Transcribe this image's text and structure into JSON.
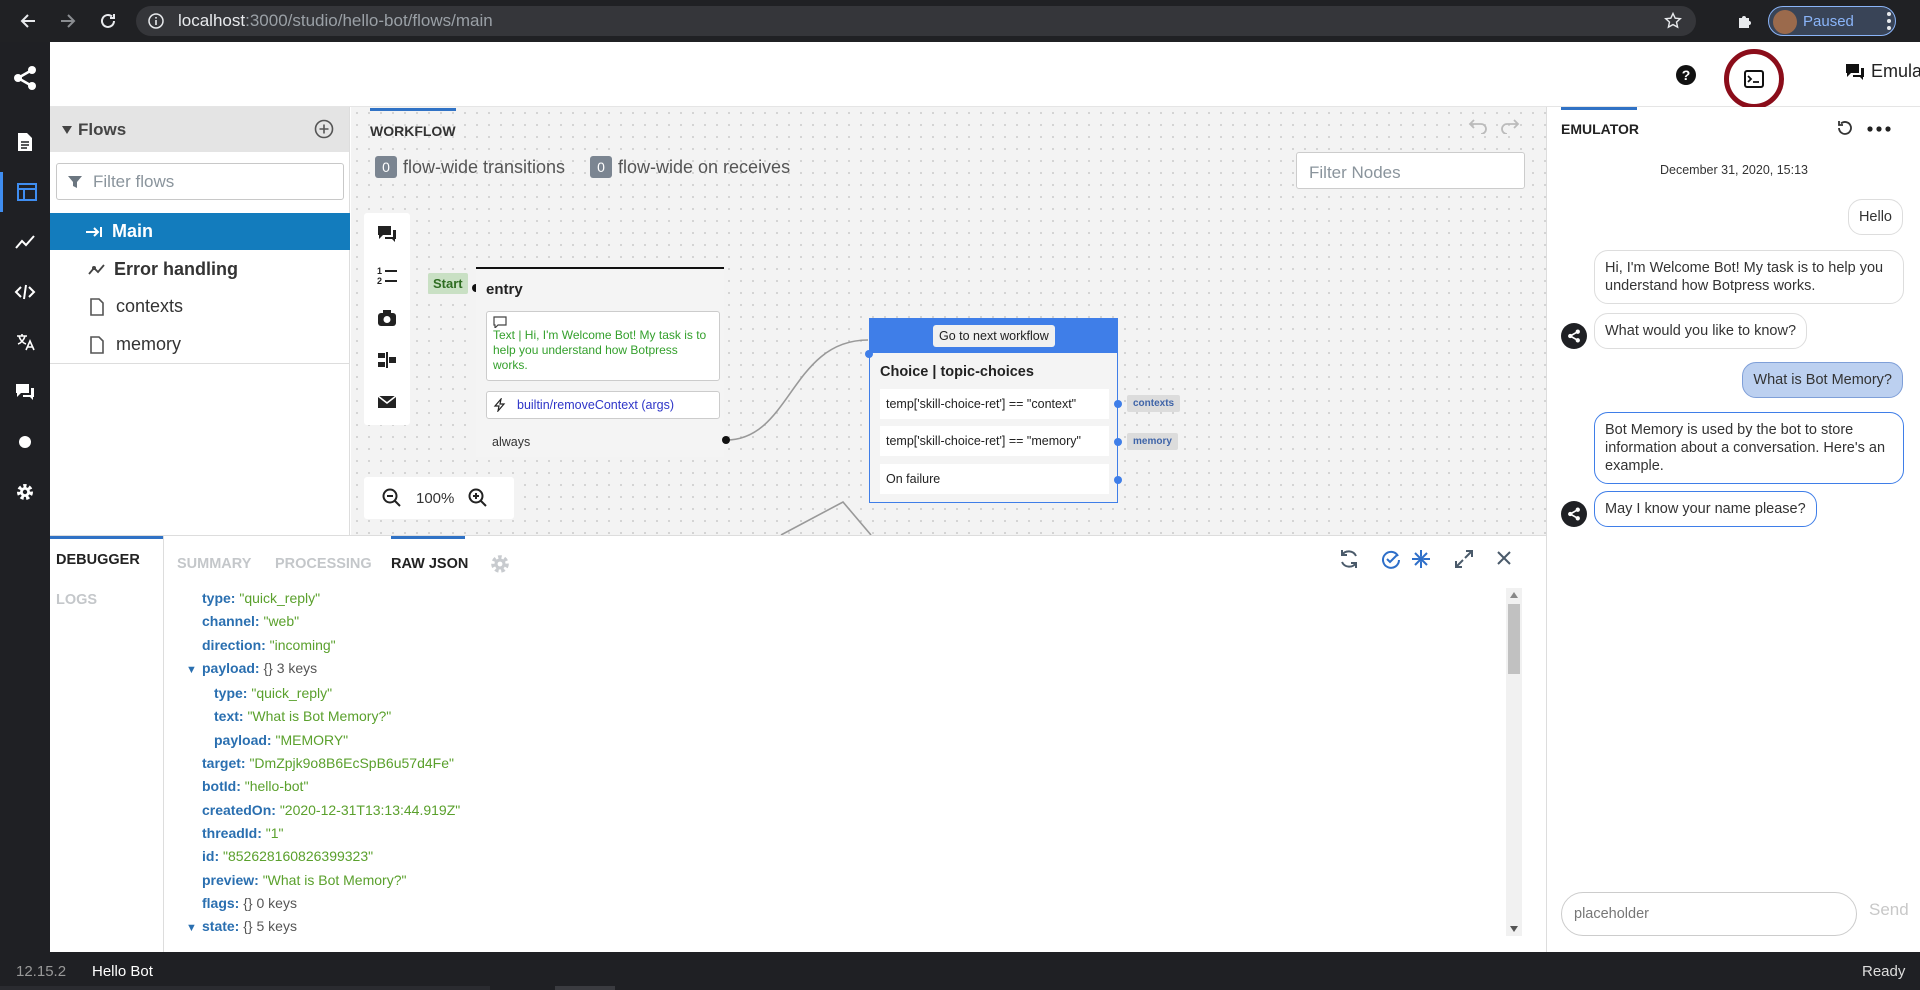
{
  "browser": {
    "url_host": "localhost",
    "url_path": ":3000/studio/hello-bot/flows/main",
    "profile_label": "Paused"
  },
  "topbar": {
    "emulator_label": "Emulator"
  },
  "flows": {
    "title": "Flows",
    "filter_placeholder": "Filter flows",
    "items": [
      {
        "label": "Main"
      },
      {
        "label": "Error handling"
      },
      {
        "label": "contexts"
      },
      {
        "label": "memory"
      }
    ]
  },
  "workflow": {
    "tab": "WORKFLOW",
    "transitions_count": "0",
    "transitions_label": "flow-wide transitions",
    "receives_count": "0",
    "receives_label": "flow-wide on receives",
    "filter_placeholder": "Filter Nodes",
    "zoom": "100%",
    "entry_node": {
      "start_label": "Start",
      "title": "entry",
      "text_content": "Text | Hi, I'm Welcome Bot! My task is to help you understand how Botpress works.",
      "action": "builtin/removeContext (args)",
      "transition": "always"
    },
    "choice_node": {
      "header_button": "Go to next workflow",
      "title": "Choice | topic-choices",
      "rows": [
        {
          "label": "temp['skill-choice-ret'] == \"context\"",
          "target": "contexts"
        },
        {
          "label": "temp['skill-choice-ret'] == \"memory\"",
          "target": "memory"
        },
        {
          "label": "On failure",
          "target": ""
        }
      ]
    }
  },
  "emulator": {
    "title": "EMULATOR",
    "timestamp": "December 31, 2020, 15:13",
    "messages": [
      {
        "from": "user",
        "text": "Hello"
      },
      {
        "from": "bot",
        "text": "Hi, I'm Welcome Bot! My task is to help you understand how Botpress works."
      },
      {
        "from": "bot",
        "text": "What would you like to know?"
      },
      {
        "from": "user",
        "text": "What is Bot Memory?"
      },
      {
        "from": "bot",
        "text": "Bot Memory is used by the bot to store information about a conversation. Here's an example."
      },
      {
        "from": "bot",
        "text": "May I know your name please?"
      }
    ],
    "input_placeholder": "placeholder",
    "send_label": "Send"
  },
  "debugger": {
    "title": "DEBUGGER",
    "logs_tab": "LOGS",
    "tabs": [
      {
        "label": "SUMMARY"
      },
      {
        "label": "PROCESSING"
      },
      {
        "label": "RAW JSON"
      }
    ],
    "json": [
      {
        "key": "type:",
        "value": "\"quick_reply\""
      },
      {
        "key": "channel:",
        "value": "\"web\""
      },
      {
        "key": "direction:",
        "value": "\"incoming\""
      },
      {
        "key": "payload:",
        "value": "{}",
        "meta": "3 keys"
      },
      {
        "key": "type:",
        "value": "\"quick_reply\""
      },
      {
        "key": "text:",
        "value": "\"What is Bot Memory?\""
      },
      {
        "key": "payload:",
        "value": "\"MEMORY\""
      },
      {
        "key": "target:",
        "value": "\"DmZpjk9o8B6EcSpB6u57d4Fe\""
      },
      {
        "key": "botId:",
        "value": "\"hello-bot\""
      },
      {
        "key": "createdOn:",
        "value": "\"2020-12-31T13:13:44.919Z\""
      },
      {
        "key": "threadId:",
        "value": "\"1\""
      },
      {
        "key": "id:",
        "value": "\"852628160826399323\""
      },
      {
        "key": "preview:",
        "value": "\"What is Bot Memory?\""
      },
      {
        "key": "flags:",
        "value": "{}",
        "meta": "0 keys"
      },
      {
        "key": "state:",
        "value": "{}",
        "meta": "5 keys"
      }
    ]
  },
  "statusbar": {
    "version": "12.15.2",
    "bot_name": "Hello Bot",
    "status": "Ready"
  },
  "colors": {
    "accent": "#137cbd",
    "highlight_ring": "#8b0d1a",
    "node_header": "#3f7ee8"
  }
}
